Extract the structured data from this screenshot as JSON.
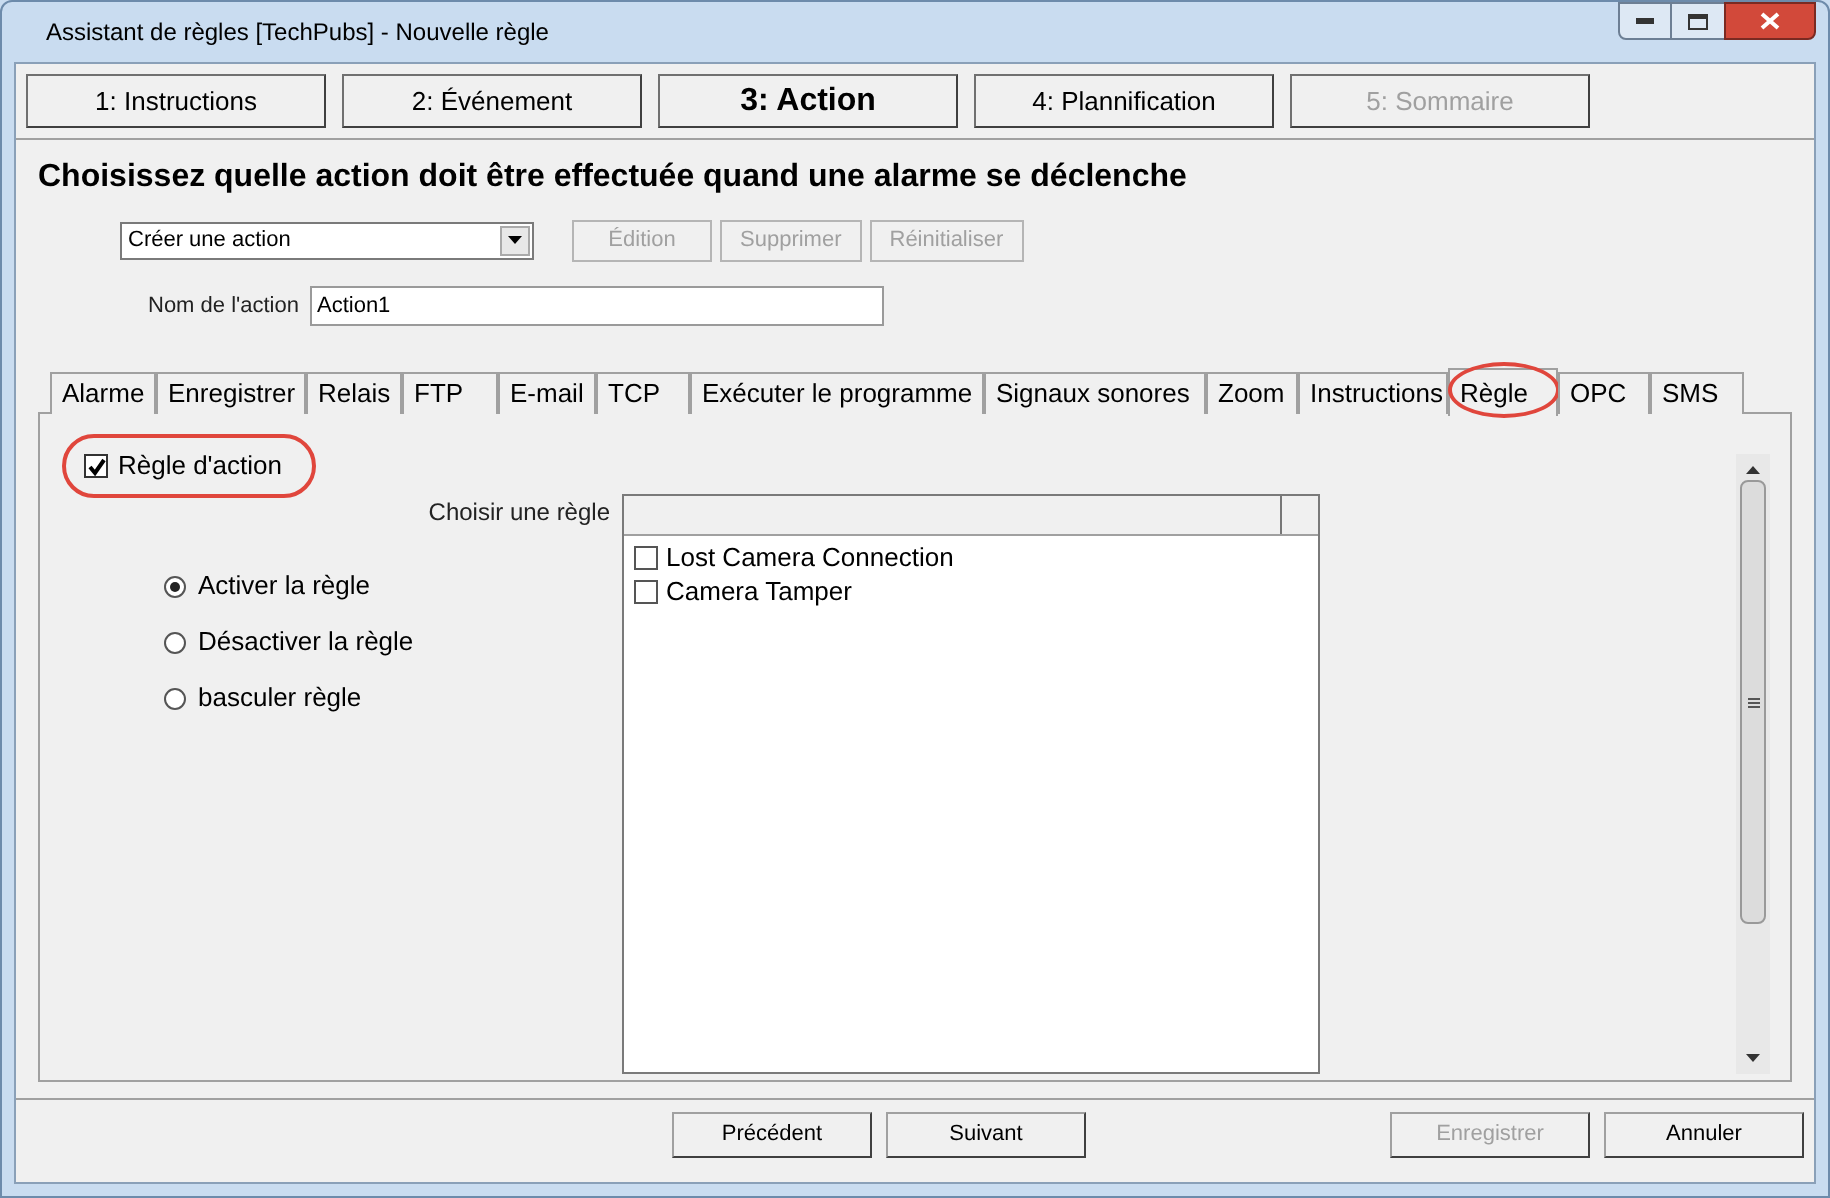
{
  "window": {
    "title": "Assistant de règles [TechPubs] - Nouvelle règle"
  },
  "steps": [
    {
      "label": "1: Instructions",
      "selected": false,
      "disabled": false
    },
    {
      "label": "2: Événement",
      "selected": false,
      "disabled": false
    },
    {
      "label": "3: Action",
      "selected": true,
      "disabled": false
    },
    {
      "label": "4: Plannification",
      "selected": false,
      "disabled": false
    },
    {
      "label": "5: Sommaire",
      "selected": false,
      "disabled": true
    }
  ],
  "heading": "Choisissez quelle action doit être effectuée quand une alarme se déclenche",
  "action_select": {
    "value": "Créer une action"
  },
  "action_buttons": [
    {
      "label": "Édition",
      "disabled": true
    },
    {
      "label": "Supprimer",
      "disabled": true
    },
    {
      "label": "Réinitialiser",
      "disabled": true
    }
  ],
  "action_name": {
    "label": "Nom de l'action",
    "value": "Action1"
  },
  "tabs": [
    {
      "label": "Alarme",
      "selected": false,
      "highlighted": false
    },
    {
      "label": "Enregistrer",
      "selected": false,
      "highlighted": false
    },
    {
      "label": "Relais",
      "selected": false,
      "highlighted": false
    },
    {
      "label": "FTP",
      "selected": false,
      "highlighted": false
    },
    {
      "label": "E-mail",
      "selected": false,
      "highlighted": false
    },
    {
      "label": "TCP",
      "selected": false,
      "highlighted": false
    },
    {
      "label": "Exécuter le programme",
      "selected": false,
      "highlighted": false
    },
    {
      "label": "Signaux sonores",
      "selected": false,
      "highlighted": false
    },
    {
      "label": "Zoom",
      "selected": false,
      "highlighted": false
    },
    {
      "label": "Instructions",
      "selected": false,
      "highlighted": false
    },
    {
      "label": "Règle",
      "selected": true,
      "highlighted": true
    },
    {
      "label": "OPC",
      "selected": false,
      "highlighted": false
    },
    {
      "label": "SMS",
      "selected": false,
      "highlighted": false
    }
  ],
  "rule_action": {
    "label": "Règle d'action",
    "checked": true,
    "highlighted": true
  },
  "choose_rule_label": "Choisir une règle",
  "rule_modes": [
    {
      "label": "Activer la règle",
      "selected": true
    },
    {
      "label": "Désactiver la règle",
      "selected": false
    },
    {
      "label": "basculer règle",
      "selected": false
    }
  ],
  "rules": [
    {
      "label": "Lost Camera Connection",
      "checked": false
    },
    {
      "label": "Camera Tamper",
      "checked": false
    }
  ],
  "footer_buttons": [
    {
      "label": "Précédent",
      "disabled": false
    },
    {
      "label": "Suivant",
      "disabled": false
    },
    {
      "label": "Enregistrer",
      "disabled": true
    },
    {
      "label": "Annuler",
      "disabled": false
    }
  ]
}
